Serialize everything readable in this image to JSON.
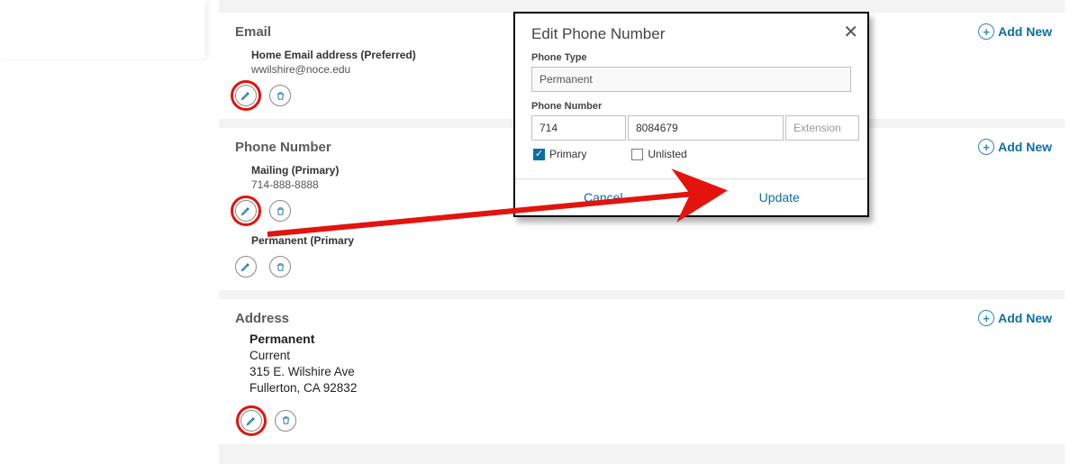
{
  "add_new_label": "Add New",
  "email": {
    "header": "Email",
    "entries": [
      {
        "title": "Home Email address (Preferred)",
        "value": "wwilshire@noce.edu"
      }
    ]
  },
  "phone": {
    "header": "Phone Number",
    "entries": [
      {
        "title": "Mailing (Primary)",
        "value": "714-888-8888"
      },
      {
        "title": "Permanent (Primary",
        "value": ""
      }
    ]
  },
  "address": {
    "header": "Address",
    "entry": {
      "label": "Permanent",
      "status": "Current",
      "line1": "315 E. Wilshire Ave",
      "line2": "Fullerton, CA 92832"
    }
  },
  "modal": {
    "title": "Edit Phone Number",
    "phone_type_label": "Phone Type",
    "phone_type_value": "Permanent",
    "phone_number_label": "Phone Number",
    "area": "714",
    "number": "8084679",
    "ext_placeholder": "Extension",
    "primary_label": "Primary",
    "unlisted_label": "Unlisted",
    "cancel": "Cancel",
    "update": "Update"
  }
}
